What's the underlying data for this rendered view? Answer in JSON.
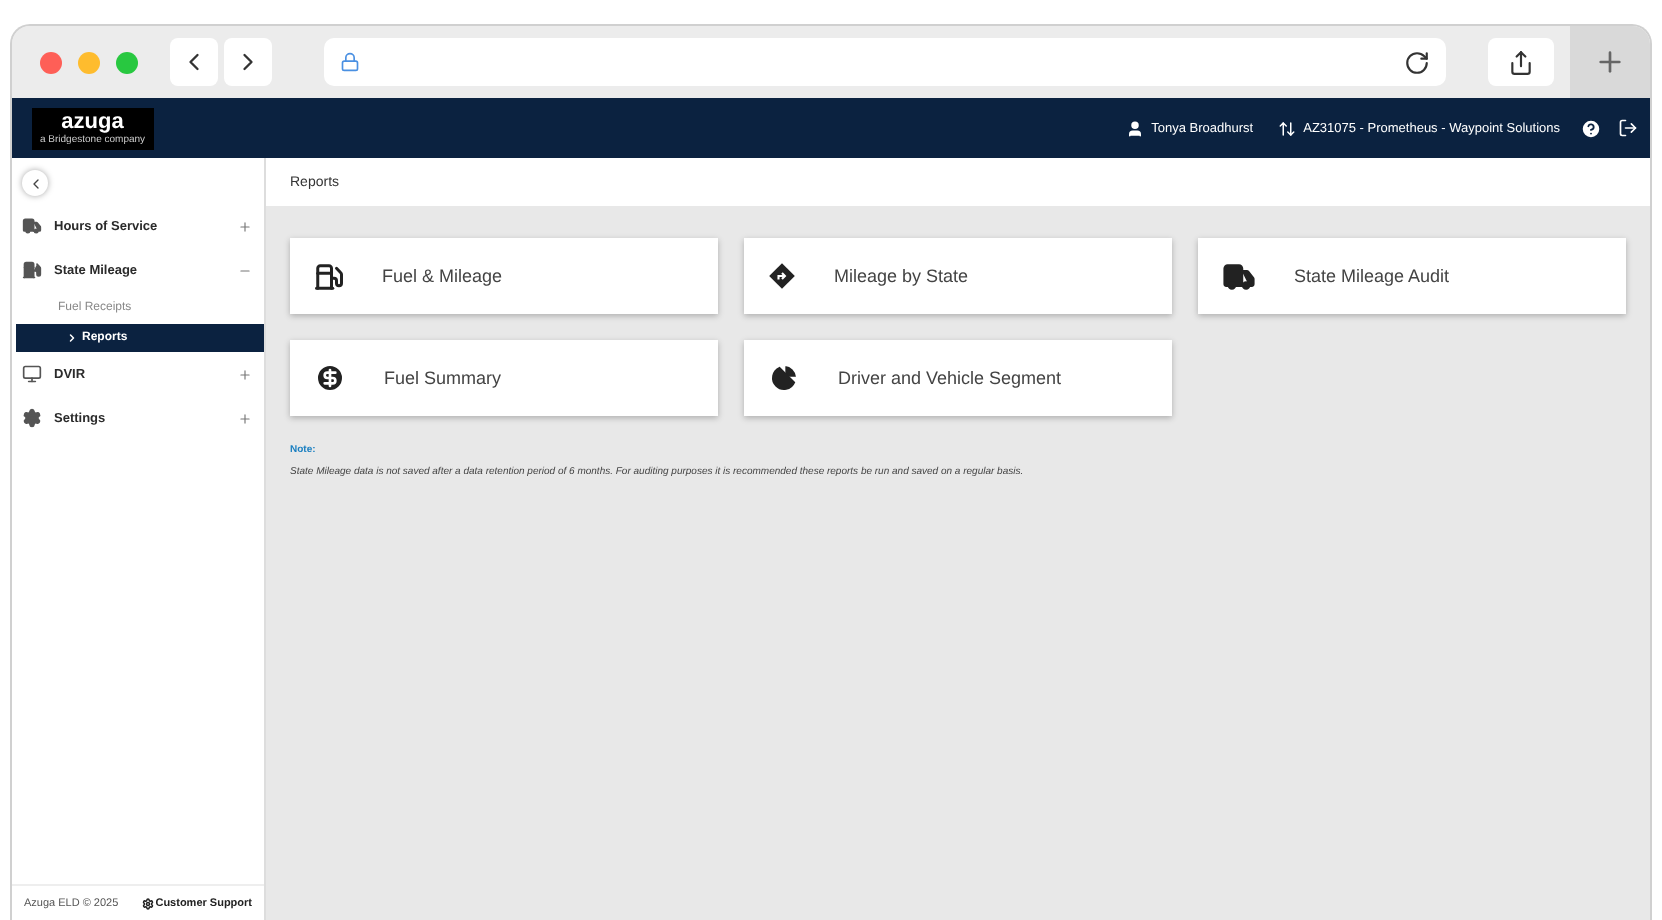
{
  "header": {
    "logo": "azuga",
    "logo_tagline": "a Bridgestone company",
    "user": "Tonya Broadhurst",
    "account": "AZ31075 - Prometheus - Waypoint Solutions"
  },
  "sidebar": {
    "items": [
      {
        "label": "Hours of Service",
        "expanded": false
      },
      {
        "label": "State Mileage",
        "expanded": true,
        "children": [
          {
            "label": "Fuel Receipts",
            "selected": false
          },
          {
            "label": "Reports",
            "selected": true
          }
        ]
      },
      {
        "label": "DVIR",
        "expanded": false
      },
      {
        "label": "Settings",
        "expanded": false
      }
    ],
    "footer": {
      "copyright": "Azuga ELD © 2025",
      "support": "Customer Support"
    }
  },
  "page": {
    "title": "Reports",
    "cards": [
      {
        "label": "Fuel & Mileage"
      },
      {
        "label": "Mileage by State"
      },
      {
        "label": "State Mileage Audit"
      },
      {
        "label": "Fuel Summary"
      },
      {
        "label": "Driver and Vehicle Segment"
      }
    ],
    "note_title": "Note:",
    "note": "State Mileage data is not saved after a data retention period of 6 months. For auditing purposes it is recommended these reports be run and saved on a regular basis."
  }
}
